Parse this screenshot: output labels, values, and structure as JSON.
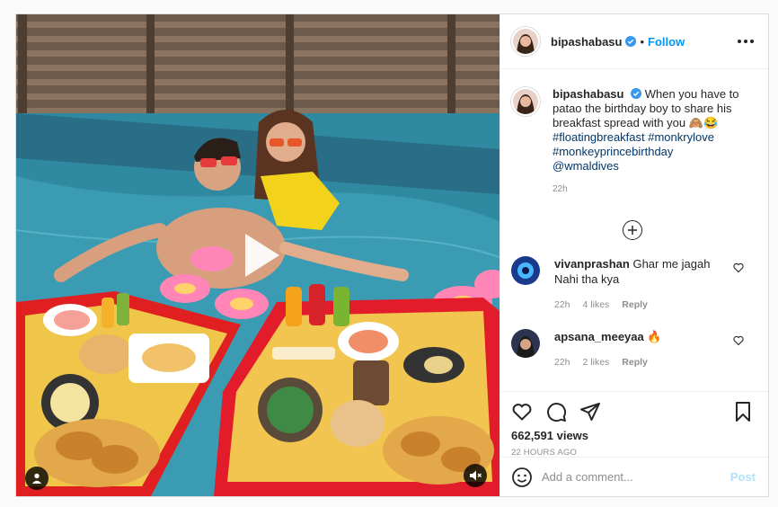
{
  "post": {
    "username": "bipashabasu",
    "follow_label": "Follow",
    "dot": "•",
    "caption": {
      "text": "When you have to patao the birthday boy to share his breakfast spread with you",
      "emoji": "🙈😂",
      "hashtags": [
        "#floatingbreakfast",
        "#monkrylove",
        "#monkeyprincebirthday"
      ],
      "mention": "@wmaldives",
      "time": "22h"
    },
    "comments": [
      {
        "username": "vivanprashan",
        "text": "Ghar me jagah Nahi tha kya",
        "time": "22h",
        "likes": "4 likes",
        "reply": "Reply",
        "avatar_color": "#1a3a8c"
      },
      {
        "username": "apsana_meeyaa",
        "text": "🔥",
        "time": "22h",
        "likes": "2 likes",
        "reply": "Reply",
        "avatar_color": "#2b3550"
      }
    ],
    "views": "662,591 views",
    "date": "22 HOURS AGO",
    "add_comment_placeholder": "Add a comment...",
    "post_button": "Post"
  },
  "icons": {
    "verified": "verified-badge-icon",
    "more": "more-options-icon",
    "load_more": "plus-circle-icon",
    "like": "heart-icon",
    "comment": "comment-icon",
    "share": "paper-plane-icon",
    "save": "bookmark-icon",
    "emoji": "emoji-icon",
    "play": "play-icon",
    "mute": "muted-speaker-icon",
    "user_tag": "user-tag-icon"
  },
  "colors": {
    "follow": "#0095f6",
    "verified": "#3897f0",
    "hashtag": "#00376b",
    "post_disabled": "#b2dffc"
  }
}
